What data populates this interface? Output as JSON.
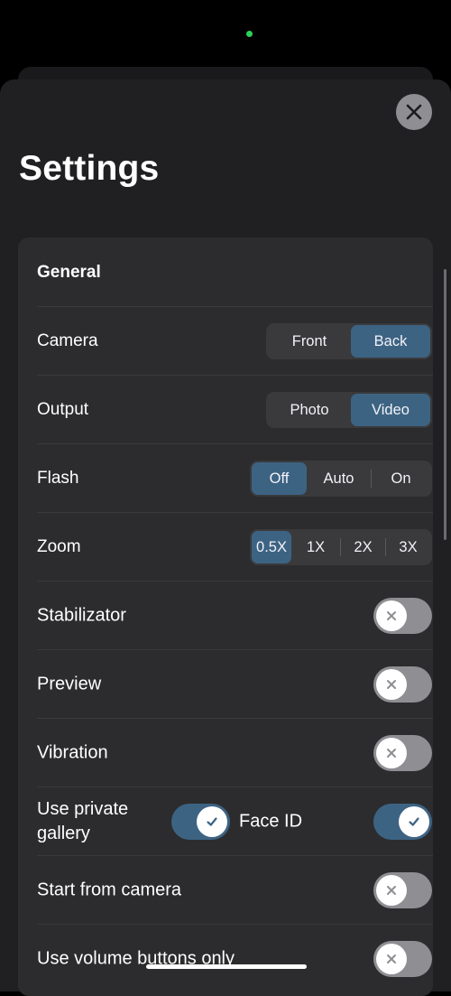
{
  "header": {
    "title": "Settings"
  },
  "general": {
    "title": "General",
    "camera": {
      "label": "Camera",
      "options": [
        "Front",
        "Back"
      ],
      "selected": "Back"
    },
    "output": {
      "label": "Output",
      "options": [
        "Photo",
        "Video"
      ],
      "selected": "Video"
    },
    "flash": {
      "label": "Flash",
      "options": [
        "Off",
        "Auto",
        "On"
      ],
      "selected": "Off"
    },
    "zoom": {
      "label": "Zoom",
      "options": [
        "0.5X",
        "1X",
        "2X",
        "3X"
      ],
      "selected": "0.5X"
    },
    "stabilizator": {
      "label": "Stabilizator",
      "on": false
    },
    "preview": {
      "label": "Preview",
      "on": false
    },
    "vibration": {
      "label": "Vibration",
      "on": false
    },
    "private_gallery": {
      "label_line1": "Use private",
      "label_line2": "gallery",
      "on": true
    },
    "face_id": {
      "label": "Face ID",
      "on": true
    },
    "start_from_camera": {
      "label": "Start from camera",
      "on": false
    },
    "volume_buttons": {
      "label": "Use volume buttons only",
      "on": false
    }
  },
  "colors": {
    "accent": "#3d6383",
    "toggle_off": "#8e8e93",
    "card": "#2c2c2e",
    "sheet": "#202023",
    "status_dot": "#2ed158"
  },
  "icons": {
    "close": "close-icon",
    "check": "check-icon",
    "cross": "x-icon"
  }
}
